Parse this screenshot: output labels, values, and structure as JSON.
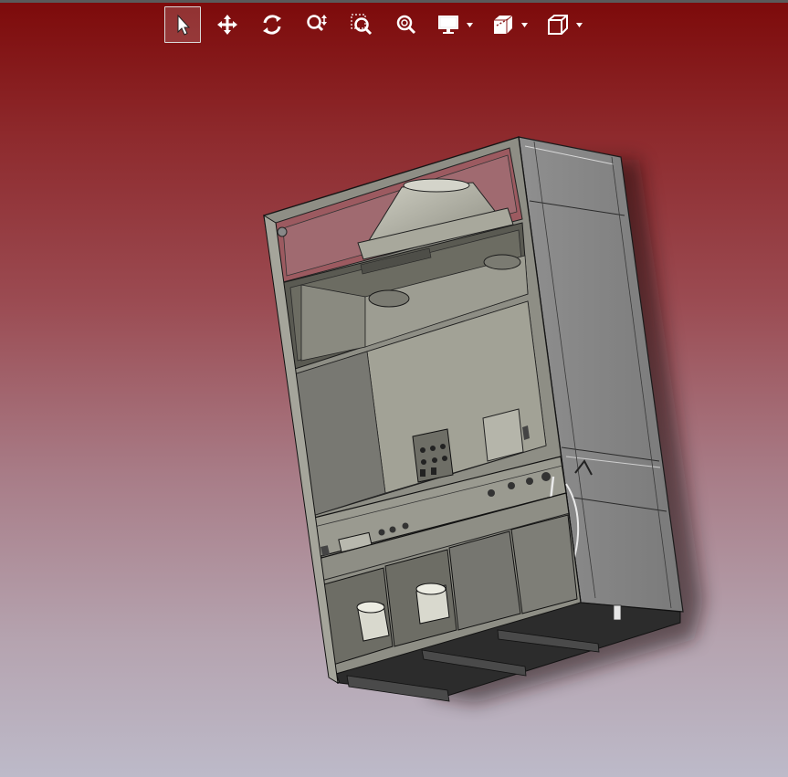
{
  "viewer": {
    "background": {
      "top": "#7d0a0a",
      "bottom": "#bdbac9"
    },
    "toolbar": {
      "active_tool": "select",
      "buttons": [
        {
          "id": "select",
          "icon": "select-arrow-icon"
        },
        {
          "id": "pan",
          "icon": "pan-move-icon"
        },
        {
          "id": "rotate",
          "icon": "rotate-icon"
        },
        {
          "id": "zoom",
          "icon": "zoom-updown-icon"
        },
        {
          "id": "zoom-window",
          "icon": "zoom-window-icon"
        },
        {
          "id": "zoom-fit",
          "icon": "zoom-fit-icon"
        },
        {
          "id": "display",
          "icon": "monitor-icon",
          "dropdown": true
        },
        {
          "id": "section",
          "icon": "section-view-icon",
          "dropdown": true
        },
        {
          "id": "view-orientation",
          "icon": "cube-view-icon",
          "dropdown": true
        }
      ]
    },
    "model": {
      "name": "",
      "material_color": "#9a9a8e"
    }
  }
}
